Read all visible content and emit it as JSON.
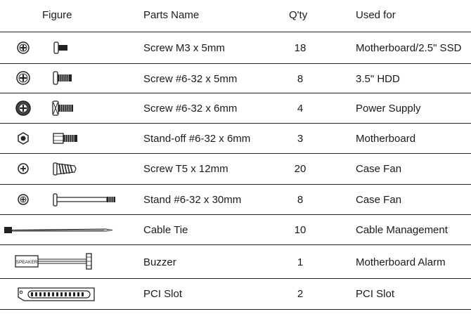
{
  "header": {
    "figure": "Figure",
    "parts_name": "Parts Name",
    "qty": "Q'ty",
    "used_for": "Used for"
  },
  "rows": [
    {
      "figure_icon": "screw-m3-icon",
      "name": "Screw M3 x 5mm",
      "qty": "18",
      "used_for": "Motherboard/2.5\" SSD"
    },
    {
      "figure_icon": "screw-6-32-5mm-icon",
      "name": "Screw #6-32 x 5mm",
      "qty": "8",
      "used_for": "3.5\" HDD"
    },
    {
      "figure_icon": "screw-6-32-6mm-icon",
      "name": "Screw #6-32 x 6mm",
      "qty": "4",
      "used_for": "Power Supply"
    },
    {
      "figure_icon": "standoff-icon",
      "name": "Stand-off #6-32 x 6mm",
      "qty": "3",
      "used_for": "Motherboard"
    },
    {
      "figure_icon": "screw-t5-icon",
      "name": "Screw T5 x 12mm",
      "qty": "20",
      "used_for": "Case Fan"
    },
    {
      "figure_icon": "stand-30mm-icon",
      "name": "Stand #6-32 x 30mm",
      "qty": "8",
      "used_for": "Case Fan"
    },
    {
      "figure_icon": "cable-tie-icon",
      "name": "Cable Tie",
      "qty": "10",
      "used_for": "Cable Management"
    },
    {
      "figure_icon": "buzzer-icon",
      "figure_text": "SPEAKER",
      "name": "Buzzer",
      "qty": "1",
      "used_for": "Motherboard Alarm"
    },
    {
      "figure_icon": "pci-slot-icon",
      "name": "PCI Slot",
      "qty": "2",
      "used_for": "PCI Slot"
    }
  ]
}
